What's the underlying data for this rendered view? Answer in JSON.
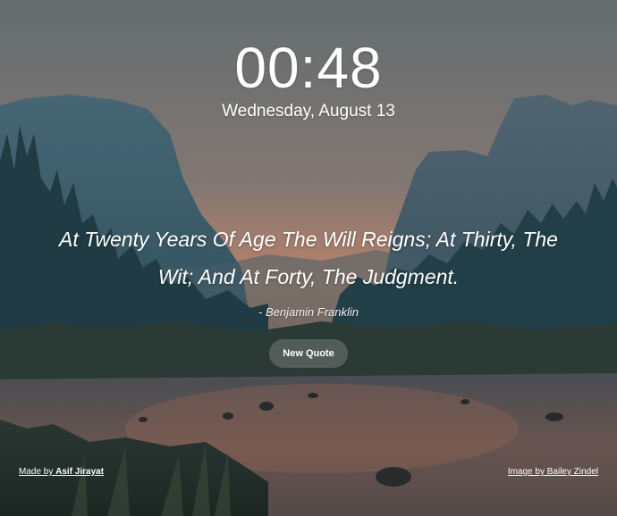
{
  "clock": {
    "time": "00:48",
    "date": "Wednesday, August 13"
  },
  "quote": {
    "text": "At Twenty Years Of Age The Will Reigns; At Thirty, The Wit; And At Forty, The Judgment.",
    "author": "- Benjamin Franklin"
  },
  "actions": {
    "new_quote_label": "New Quote"
  },
  "footer": {
    "made_by_prefix": "Made by ",
    "made_by_name": "Asif Jirayat",
    "image_credit": "Image by Bailey Zindel"
  },
  "background": {
    "description_icon": "valley-landscape-image",
    "sky_top": "#6f7a80",
    "sunset_glow": "#c98a6e",
    "mountain_color": "#3e5d6b",
    "forest_color": "#24404a",
    "river_color": "#4a4e55"
  }
}
